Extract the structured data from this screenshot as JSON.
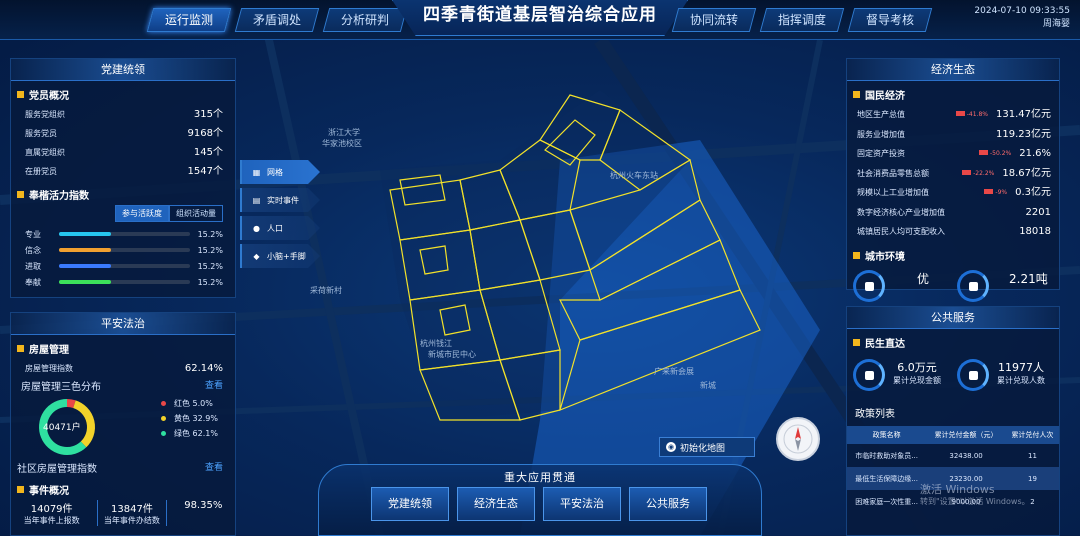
{
  "app": {
    "title": "四季青街道基层智治综合应用",
    "date": "2024-07-10 09:33:55",
    "user": "周海婴"
  },
  "nav": [
    {
      "label": "运行监测"
    },
    {
      "label": "矛盾调处"
    },
    {
      "label": "分析研判"
    },
    {
      "label": "协同流转"
    },
    {
      "label": "指挥调度"
    },
    {
      "label": "督导考核"
    }
  ],
  "party": {
    "title": "党建统领",
    "section1": "党员概况",
    "stats": [
      {
        "label": "服务党组织",
        "value": "315个"
      },
      {
        "label": "服务党员",
        "value": "9168个"
      },
      {
        "label": "直属党组织",
        "value": "145个"
      },
      {
        "label": "在册党员",
        "value": "1547个"
      }
    ],
    "section2": "奉楷活力指数",
    "tabs": [
      "参与活跃度",
      "组织活动量"
    ],
    "bars": [
      {
        "label": "专业",
        "value": "15.2%",
        "pct": 0.152,
        "color": "#26c6f0"
      },
      {
        "label": "信念",
        "value": "15.2%",
        "pct": 0.152,
        "color": "#f0a030"
      },
      {
        "label": "进取",
        "value": "15.2%",
        "pct": 0.152,
        "color": "#3a7bff"
      },
      {
        "label": "奉献",
        "value": "15.2%",
        "pct": 0.152,
        "color": "#3ce05a"
      }
    ]
  },
  "safety": {
    "title": "平安法治",
    "section1": "房屋管理",
    "index_label": "房屋管理指数",
    "index_value": "62.14%",
    "dist_title": "房屋管理三色分布",
    "view": "查看",
    "donut_center": "40471户",
    "legend": [
      {
        "label": "红色",
        "value": "5.0%",
        "pct": 0.05,
        "color": "#e84848"
      },
      {
        "label": "黄色",
        "value": "32.9%",
        "pct": 0.329,
        "color": "#f2d22a"
      },
      {
        "label": "绿色",
        "value": "62.1%",
        "pct": 0.621,
        "color": "#2fe0a0"
      }
    ],
    "community_label": "社区房屋管理指数",
    "community_view": "查看",
    "section2": "事件概况",
    "events": [
      {
        "value": "14079件",
        "label": "当年事件上报数"
      },
      {
        "value": "13847件",
        "label": "当年事件办结数"
      },
      {
        "value": "98.35%",
        "label": ""
      }
    ]
  },
  "map": {
    "side": [
      {
        "label": "网格"
      },
      {
        "label": "实时事件"
      },
      {
        "label": "人口"
      },
      {
        "label": "小脑+手脚"
      }
    ],
    "labels": [
      "浙江大学",
      "华家池校区",
      "采荷新村",
      "杭州钱江",
      "新城市民中心",
      "广来新会展",
      "杭州火车东站",
      "新城"
    ],
    "init_button": "初始化地图"
  },
  "bottom": {
    "title": "重大应用贯通",
    "buttons": [
      "党建统领",
      "经济生态",
      "平安法治",
      "公共服务"
    ]
  },
  "economy": {
    "title": "经济生态",
    "section1": "国民经济",
    "rows": [
      {
        "label": "地区生产总值",
        "change": "-41.8%",
        "value": "131.47亿元"
      },
      {
        "label": "服务业增加值",
        "change": "",
        "value": "119.23亿元"
      },
      {
        "label": "固定资产投资",
        "change": "-50.2%",
        "value": "21.6%"
      },
      {
        "label": "社会消费品零售总额",
        "change": "-22.2%",
        "value": "18.67亿元"
      },
      {
        "label": "规模以上工业增加值",
        "change": "-9%",
        "value": "0.3亿元"
      },
      {
        "label": "数字经济核心产业增加值",
        "change": "",
        "value": "2201"
      },
      {
        "label": "城镇居民人均可支配收入",
        "change": "",
        "value": "18018"
      }
    ],
    "section2": "城市环境",
    "env": [
      {
        "value": "优"
      },
      {
        "value": "2.21吨"
      }
    ]
  },
  "public": {
    "title": "公共服务",
    "section1": "民生直达",
    "stats": [
      {
        "value": "6.0万元",
        "label": "累计兑现金额"
      },
      {
        "value": "11977人",
        "label": "累计兑现人数"
      }
    ],
    "list_title": "政策列表",
    "columns": [
      "政策名称",
      "累计兑付金额（元）",
      "累计兑付人次"
    ],
    "rows": [
      {
        "name": "市临时救助对象员...",
        "amount": "32438.00",
        "count": "11"
      },
      {
        "name": "最低生活保障边缘...",
        "amount": "23230.00",
        "count": "19"
      },
      {
        "name": "困难家庭一次性重...",
        "amount": "9000.00",
        "count": "2"
      }
    ]
  },
  "watermark": {
    "line1": "激活 Windows",
    "line2": "转到\"设置\"以激活 Windows。"
  }
}
